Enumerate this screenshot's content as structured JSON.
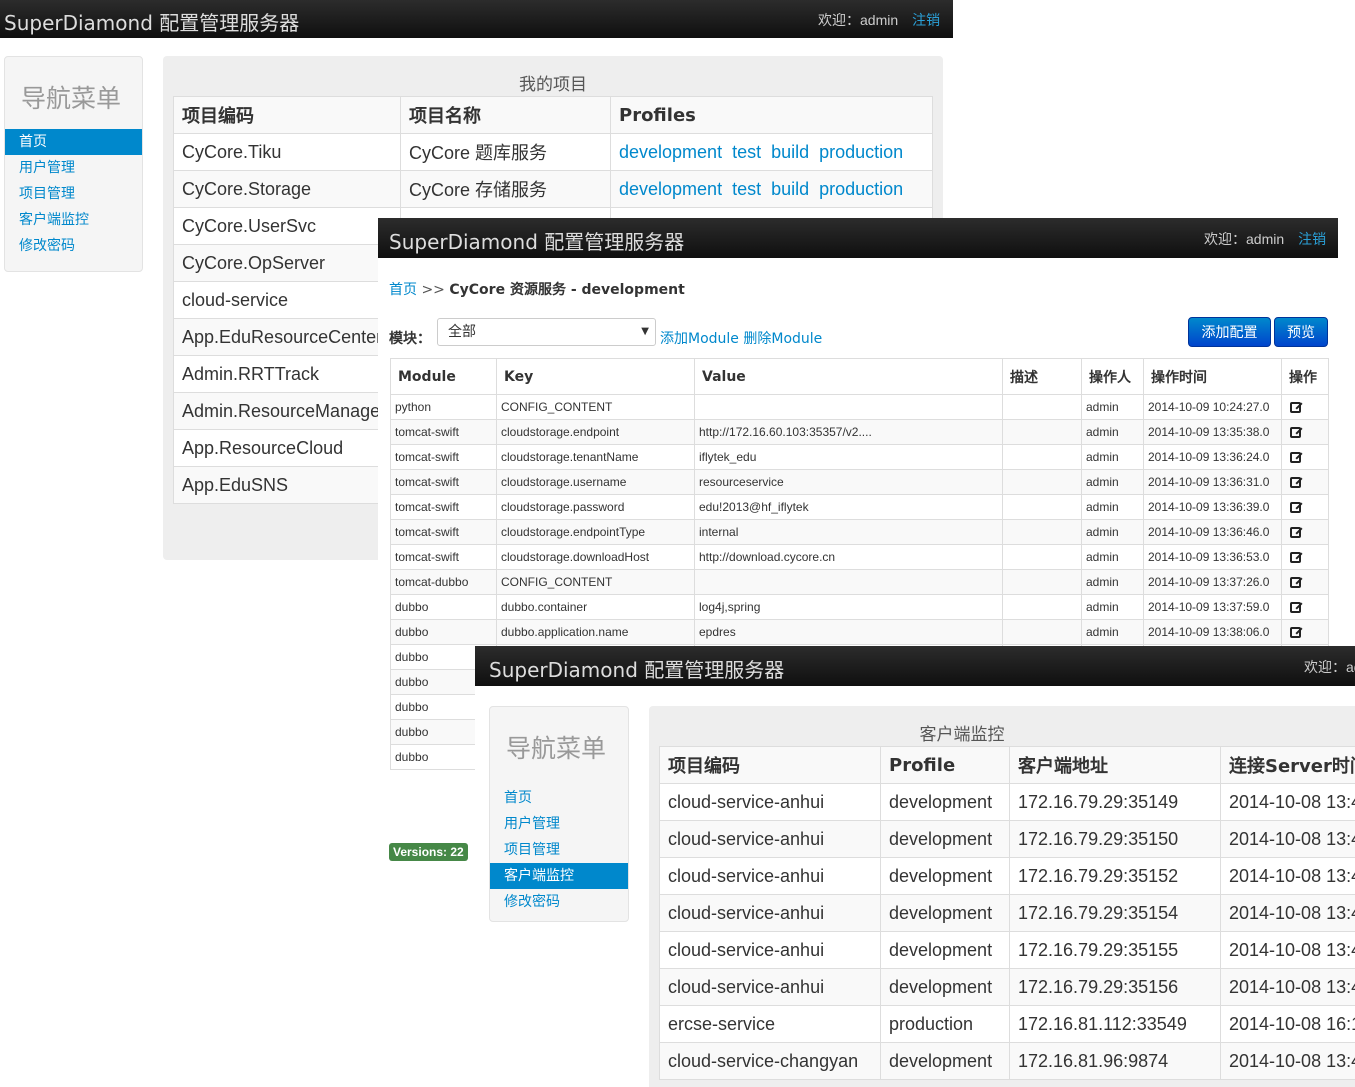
{
  "brand": "SuperDiamond",
  "brand_suffix": "配置管理服务器",
  "welcome_label": "欢迎：",
  "user": "admin",
  "logout": "注销",
  "nav": {
    "title": "导航菜单",
    "items": [
      "首页",
      "用户管理",
      "项目管理",
      "客户端监控",
      "修改密码"
    ]
  },
  "projects": {
    "caption": "我的项目",
    "headers": [
      "项目编码",
      "项目名称",
      "Profiles"
    ],
    "rows": [
      {
        "code": "CyCore.Tiku",
        "name": "CyCore 题库服务",
        "profiles": [
          "development",
          "test",
          "build",
          "production"
        ]
      },
      {
        "code": "CyCore.Storage",
        "name": "CyCore 存储服务",
        "profiles": [
          "development",
          "test",
          "build",
          "production"
        ]
      },
      {
        "code": "CyCore.UserSvc",
        "name": "",
        "profiles": []
      },
      {
        "code": "CyCore.OpServer",
        "name": "",
        "profiles": []
      },
      {
        "code": "cloud-service",
        "name": "",
        "profiles": []
      },
      {
        "code": "App.EduResourceCenter",
        "name": "",
        "profiles": []
      },
      {
        "code": "Admin.RRTTrack",
        "name": "",
        "profiles": []
      },
      {
        "code": "Admin.ResourceManage",
        "name": "",
        "profiles": []
      },
      {
        "code": "App.ResourceCloud",
        "name": "",
        "profiles": []
      },
      {
        "code": "App.EduSNS",
        "name": "",
        "profiles": []
      }
    ]
  },
  "config": {
    "breadcrumb_home": "首页",
    "breadcrumb_sep": ">>",
    "breadcrumb_current": "CyCore 资源服务 - development",
    "module_label": "模块：",
    "module_selected": "全部",
    "add_module": "添加Module",
    "delete_module": "删除Module",
    "add_config": "添加配置",
    "preview": "预览",
    "versions": "Versions: 22",
    "headers": [
      "Module",
      "Key",
      "Value",
      "描述",
      "操作人",
      "操作时间",
      "操作"
    ],
    "rows": [
      [
        "python",
        "CONFIG_CONTENT",
        "",
        "",
        "admin",
        "2014-10-09 10:24:27.0"
      ],
      [
        "tomcat-swift",
        "cloudstorage.endpoint",
        "http://172.16.60.103:35357/v2....",
        "",
        "admin",
        "2014-10-09 13:35:38.0"
      ],
      [
        "tomcat-swift",
        "cloudstorage.tenantName",
        "iflytek_edu",
        "",
        "admin",
        "2014-10-09 13:36:24.0"
      ],
      [
        "tomcat-swift",
        "cloudstorage.username",
        "resourceservice",
        "",
        "admin",
        "2014-10-09 13:36:31.0"
      ],
      [
        "tomcat-swift",
        "cloudstorage.password",
        "edu!2013@hf_iflytek",
        "",
        "admin",
        "2014-10-09 13:36:39.0"
      ],
      [
        "tomcat-swift",
        "cloudstorage.endpointType",
        "internal",
        "",
        "admin",
        "2014-10-09 13:36:46.0"
      ],
      [
        "tomcat-swift",
        "cloudstorage.downloadHost",
        "http://download.cycore.cn",
        "",
        "admin",
        "2014-10-09 13:36:53.0"
      ],
      [
        "tomcat-dubbo",
        "CONFIG_CONTENT",
        "",
        "",
        "admin",
        "2014-10-09 13:37:26.0"
      ],
      [
        "dubbo",
        "dubbo.container",
        "log4j,spring",
        "",
        "admin",
        "2014-10-09 13:37:59.0"
      ],
      [
        "dubbo",
        "dubbo.application.name",
        "epdres",
        "",
        "admin",
        "2014-10-09 13:38:06.0"
      ],
      [
        "dubbo",
        "",
        "",
        "",
        "",
        ""
      ],
      [
        "dubbo",
        "",
        "",
        "",
        "",
        ""
      ],
      [
        "dubbo",
        "",
        "",
        "",
        "",
        ""
      ],
      [
        "dubbo",
        "",
        "",
        "",
        "",
        ""
      ],
      [
        "dubbo",
        "",
        "",
        "",
        "",
        ""
      ]
    ]
  },
  "monitor": {
    "caption": "客户端监控",
    "headers": [
      "项目编码",
      "Profile",
      "客户端地址",
      "连接Server时间"
    ],
    "rows": [
      [
        "cloud-service-anhui",
        "development",
        "172.16.79.29:35149",
        "2014-10-08 13:4"
      ],
      [
        "cloud-service-anhui",
        "development",
        "172.16.79.29:35150",
        "2014-10-08 13:4"
      ],
      [
        "cloud-service-anhui",
        "development",
        "172.16.79.29:35152",
        "2014-10-08 13:4"
      ],
      [
        "cloud-service-anhui",
        "development",
        "172.16.79.29:35154",
        "2014-10-08 13:4"
      ],
      [
        "cloud-service-anhui",
        "development",
        "172.16.79.29:35155",
        "2014-10-08 13:4"
      ],
      [
        "cloud-service-anhui",
        "development",
        "172.16.79.29:35156",
        "2014-10-08 13:4"
      ],
      [
        "ercse-service",
        "production",
        "172.16.81.112:33549",
        "2014-10-08 16:1"
      ],
      [
        "cloud-service-changyan",
        "development",
        "172.16.81.96:9874",
        "2014-10-08 13:4"
      ]
    ]
  }
}
